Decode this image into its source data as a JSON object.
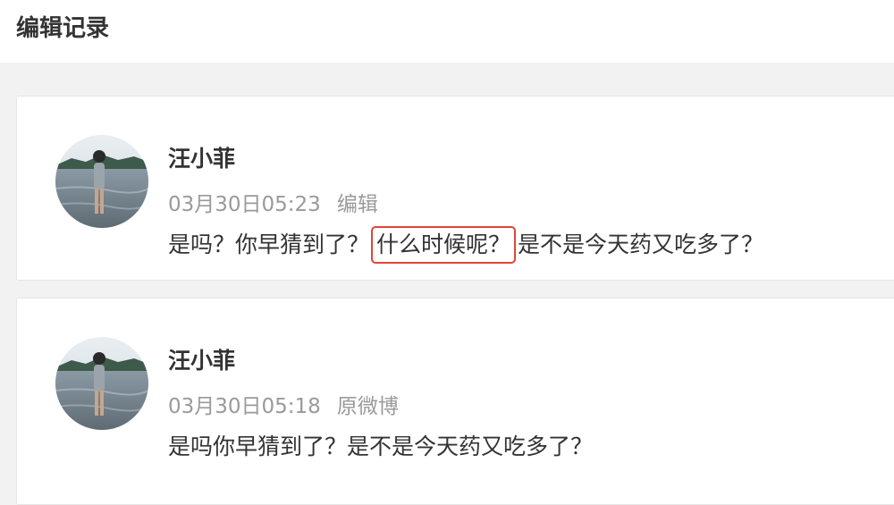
{
  "header": {
    "title": "编辑记录"
  },
  "records": [
    {
      "author": "汪小菲",
      "time": "03月30日05:23",
      "tag": "编辑",
      "text_before": "是吗？你早猜到了？",
      "text_highlight": "什么时候呢？",
      "text_after": "是不是今天药又吃多了？"
    },
    {
      "author": "汪小菲",
      "time": "03月30日05:18",
      "tag": "原微博",
      "text": "是吗你早猜到了？是不是今天药又吃多了？"
    }
  ],
  "colors": {
    "highlight_border": "#e0463a",
    "meta_text": "#9a9a9a",
    "body_text": "#333333"
  }
}
